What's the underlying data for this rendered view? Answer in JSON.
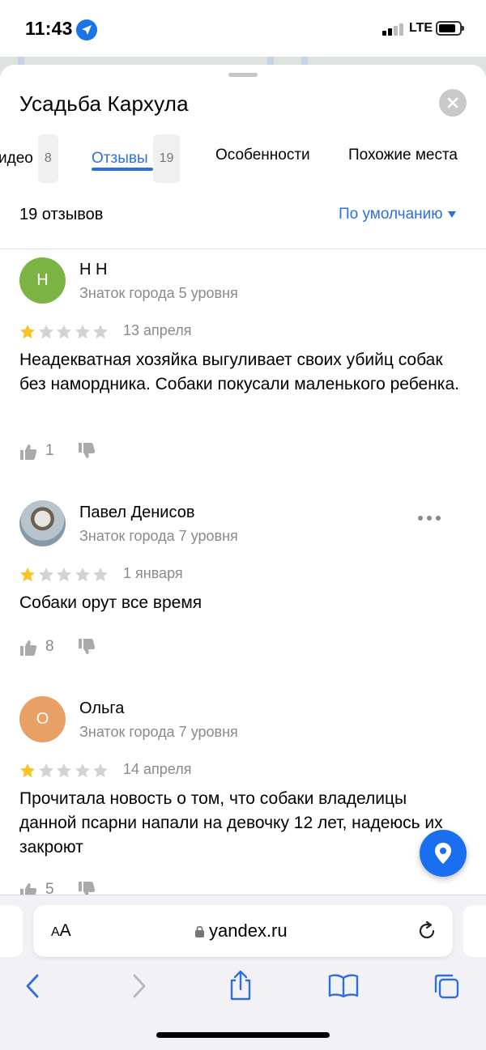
{
  "status_bar": {
    "time": "11:43",
    "network": "LTE",
    "signal_bars": 2,
    "battery_level": 0.85
  },
  "place": {
    "title": "Усадьба Кархула"
  },
  "tabs": [
    {
      "label": "идео",
      "count": "8"
    },
    {
      "label": "Отзывы",
      "count": "19",
      "active": true
    },
    {
      "label": "Особенности"
    },
    {
      "label": "Похожие места"
    }
  ],
  "reviews_header": {
    "summary": "19 отзывов",
    "sort_label": "По умолчанию"
  },
  "reviews": [
    {
      "avatar_letter": "Н",
      "avatar_color": "#7cb342",
      "name": "Н Н",
      "level": "Знаток города 5 уровня",
      "rating": 1,
      "date": "13 апреля",
      "text": "Неадекватная хозяйка выгуливает своих убийц собак без намордника. Собаки покусали маленького ребенка.",
      "likes": "1"
    },
    {
      "avatar_letter": "",
      "avatar_color": "photo",
      "name": "Павел Денисов",
      "level": "Знаток города 7 уровня",
      "rating": 1,
      "date": "1 января",
      "text": "Собаки орут все время",
      "likes": "8"
    },
    {
      "avatar_letter": "О",
      "avatar_color": "#e8a065",
      "name": "Ольга",
      "level": "Знаток города 7 уровня",
      "rating": 1,
      "date": "14 апреля",
      "text": "Прочитала новость о том, что собаки владелицы данной псарни напали на девочку 12 лет, надеюсь их закроют",
      "likes": "5"
    }
  ],
  "browser": {
    "aa_label_small": "A",
    "aa_label": "A",
    "url": "yandex.ru"
  },
  "colors": {
    "accent": "#2f6fdb",
    "star_filled": "#f7c325",
    "star_empty": "#d3d3d3",
    "fab": "#1a6ff0"
  },
  "icons": {
    "close": "close-icon",
    "sort": "chevron-down-icon",
    "like": "thumbs-up-icon",
    "dislike": "thumbs-down-icon",
    "more": "more-horizontal-icon",
    "fab": "location-pin-icon",
    "lock": "lock-icon",
    "reload": "reload-icon",
    "back": "chevron-left-icon",
    "forward": "chevron-right-icon",
    "share": "share-icon",
    "bookmarks": "book-icon",
    "tabs": "tabs-icon"
  }
}
